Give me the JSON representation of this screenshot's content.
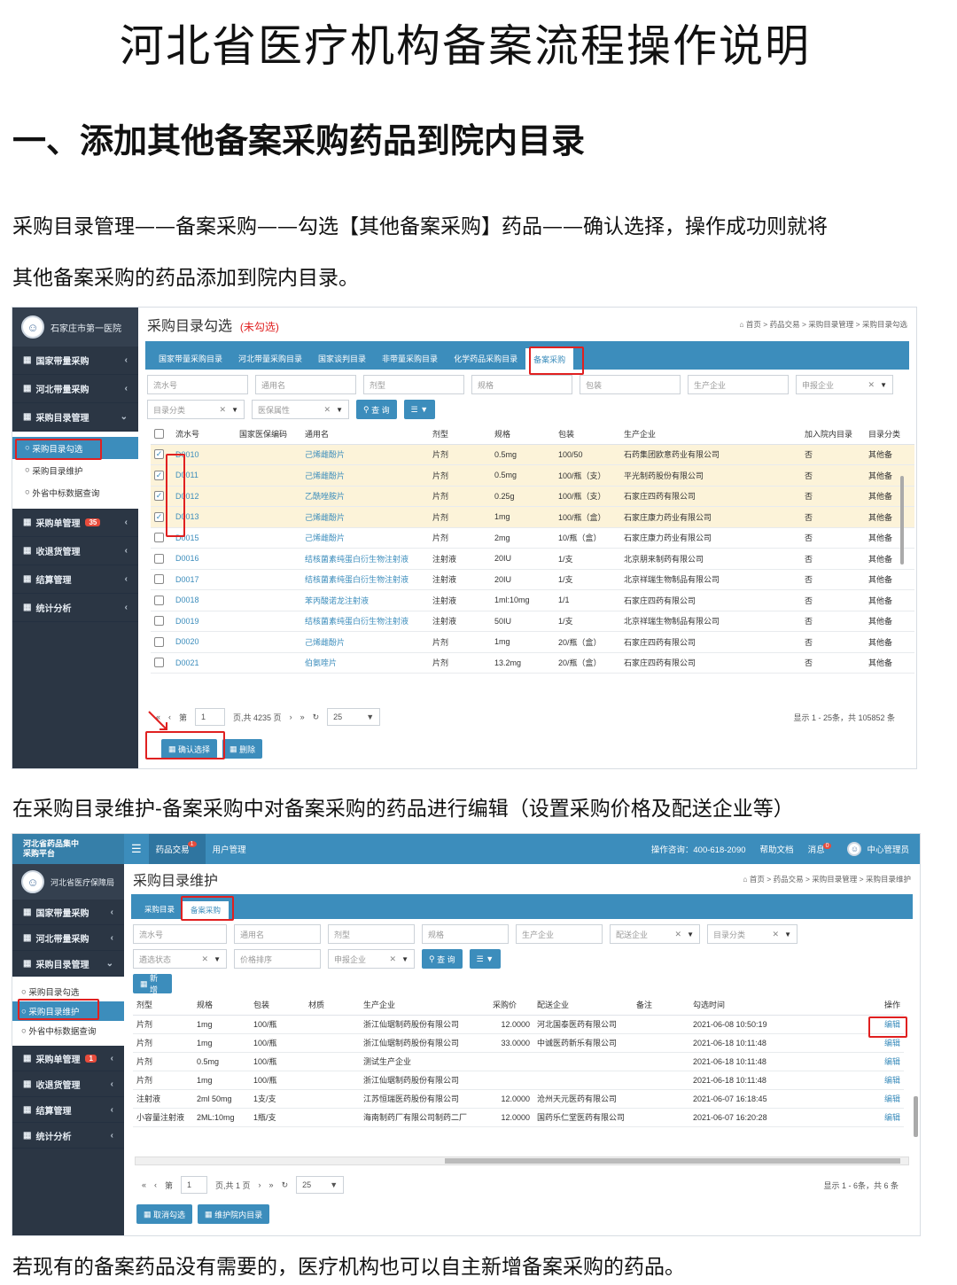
{
  "doc": {
    "title": "河北省医疗机构备案流程操作说明",
    "section1": "一、添加其他备案采购药品到院内目录",
    "para1": "采购目录管理——备案采购——勾选【其他备案采购】药品——确认选择，操作成功则就将",
    "para2": "其他备案采购的药品添加到院内目录。",
    "para3": "在采购目录维护-备案采购中对备案采购的药品进行编辑（设置采购价格及配送企业等）",
    "para4": "若现有的备案药品没有需要的，医疗机构也可以自主新增备案采购的药品。"
  },
  "shot1": {
    "user": "石家庄市第一医院",
    "menu": [
      {
        "label": "国家带量采购"
      },
      {
        "label": "河北带量采购"
      },
      {
        "label": "采购目录管理"
      }
    ],
    "submenu": [
      "采购目录勾选",
      "采购目录维护",
      "外省中标数据查询"
    ],
    "menu2": [
      {
        "label": "采购单管理",
        "badge": "35"
      },
      {
        "label": "收退货管理"
      },
      {
        "label": "结算管理"
      },
      {
        "label": "统计分析"
      }
    ],
    "page_title": "采购目录勾选",
    "page_note": "(未勾选)",
    "breadcrumb": [
      "首页",
      "药品交易",
      "采购目录管理",
      "采购目录勾选"
    ],
    "tabs": [
      "国家带量采购目录",
      "河北带量采购目录",
      "国家谈判目录",
      "非带量采购目录",
      "化学药品采购目录",
      "备案采购"
    ],
    "filters_row1": [
      "流水号",
      "通用名",
      "剂型",
      "规格",
      "包装",
      "生产企业",
      "申报企业"
    ],
    "filters_row2": [
      "目录分类",
      "医保属性"
    ],
    "search_label": "查 询",
    "headers": [
      "流水号",
      "国家医保编码",
      "通用名",
      "剂型",
      "规格",
      "包装",
      "生产企业",
      "加入院内目录",
      "目录分类"
    ],
    "rows": [
      {
        "id": "D0010",
        "name": "己烯雌酚片",
        "form": "片剂",
        "spec": "0.5mg",
        "pack": "100/50",
        "maker": "石药集团欧意药业有限公司",
        "joined": "否",
        "cat": "其他备"
      },
      {
        "id": "D0011",
        "name": "己烯雌酚片",
        "form": "片剂",
        "spec": "0.5mg",
        "pack": "100/瓶（支）",
        "maker": "平光制药股份有限公司",
        "joined": "否",
        "cat": "其他备"
      },
      {
        "id": "D0012",
        "name": "乙酰唑胺片",
        "form": "片剂",
        "spec": "0.25g",
        "pack": "100/瓶（支）",
        "maker": "石家庄四药有限公司",
        "joined": "否",
        "cat": "其他备"
      },
      {
        "id": "D0013",
        "name": "己烯雌酚片",
        "form": "片剂",
        "spec": "1mg",
        "pack": "100/瓶（盒）",
        "maker": "石家庄康力药业有限公司",
        "joined": "否",
        "cat": "其他备"
      },
      {
        "id": "D0015",
        "name": "己烯雌酚片",
        "form": "片剂",
        "spec": "2mg",
        "pack": "10/瓶（盒）",
        "maker": "石家庄康力药业有限公司",
        "joined": "否",
        "cat": "其他备"
      },
      {
        "id": "D0016",
        "name": "结核菌素纯蛋白衍生物注射液",
        "form": "注射液",
        "spec": "20IU",
        "pack": "1/支",
        "maker": "北京朋来制药有限公司",
        "joined": "否",
        "cat": "其他备"
      },
      {
        "id": "D0017",
        "name": "结核菌素纯蛋白衍生物注射液",
        "form": "注射液",
        "spec": "20IU",
        "pack": "1/支",
        "maker": "北京祥瑞生物制品有限公司",
        "joined": "否",
        "cat": "其他备"
      },
      {
        "id": "D0018",
        "name": "苯丙酸诺龙注射液",
        "form": "注射液",
        "spec": "1ml:10mg",
        "pack": "1/1",
        "maker": "石家庄四药有限公司",
        "joined": "否",
        "cat": "其他备"
      },
      {
        "id": "D0019",
        "name": "结核菌素纯蛋白衍生物注射液",
        "form": "注射液",
        "spec": "50IU",
        "pack": "1/支",
        "maker": "北京祥瑞生物制品有限公司",
        "joined": "否",
        "cat": "其他备"
      },
      {
        "id": "D0020",
        "name": "己烯雌酚片",
        "form": "片剂",
        "spec": "1mg",
        "pack": "20/瓶（盒）",
        "maker": "石家庄四药有限公司",
        "joined": "否",
        "cat": "其他备"
      },
      {
        "id": "D0021",
        "name": "伯氨喹片",
        "form": "片剂",
        "spec": "13.2mg",
        "pack": "20/瓶（盒）",
        "maker": "石家庄四药有限公司",
        "joined": "否",
        "cat": "其他备"
      }
    ],
    "pager": {
      "page_label": "第",
      "page": "1",
      "total": "页,共 4235 页",
      "size": "25",
      "summary": "显示 1 - 25条，共 105852 条"
    },
    "btn_confirm": "确认选择",
    "btn_delete": "删除"
  },
  "shot2": {
    "brand_line1": "河北省药品集中",
    "brand_line2": "采购平台",
    "top_menu": [
      "药品交易",
      "用户管理"
    ],
    "top_badge": "1",
    "hotline": "操作咨询：400-618-2090",
    "help": "帮助文档",
    "msg": "消息",
    "msg_badge": "0",
    "admin": "中心管理员",
    "user": "河北省医疗保障局",
    "menu": [
      "国家带量采购",
      "河北带量采购",
      "采购目录管理"
    ],
    "submenu": [
      "采购目录勾选",
      "采购目录维护",
      "外省中标数据查询"
    ],
    "menu2": [
      {
        "label": "采购单管理",
        "badge": "1"
      },
      {
        "label": "收退货管理"
      },
      {
        "label": "结算管理"
      },
      {
        "label": "统计分析"
      }
    ],
    "page_title": "采购目录维护",
    "breadcrumb": [
      "首页",
      "药品交易",
      "采购目录管理",
      "采购目录维护"
    ],
    "tabs": [
      "采购目录",
      "备案采购"
    ],
    "filters_row1": [
      "流水号",
      "通用名",
      "剂型",
      "规格",
      "生产企业",
      "配送企业",
      "目录分类"
    ],
    "filters_row2": [
      "遴选状态",
      "价格排序",
      "申报企业"
    ],
    "search_label": "查 询",
    "add_label": "新增",
    "headers": [
      "剂型",
      "规格",
      "包装",
      "材质",
      "生产企业",
      "采购价",
      "配送企业",
      "备注",
      "勾选时间",
      "操作"
    ],
    "rows": [
      {
        "form": "片剂",
        "spec": "1mg",
        "pack": "100/瓶",
        "maker": "浙江仙琚制药股份有限公司",
        "price": "12.0000",
        "dist": "河北国泰医药有限公司",
        "time": "2021-06-08 10:50:19",
        "op": "编辑"
      },
      {
        "form": "片剂",
        "spec": "1mg",
        "pack": "100/瓶",
        "maker": "浙江仙琚制药股份有限公司",
        "price": "33.0000",
        "dist": "中诚医药新乐有限公司",
        "time": "2021-06-18 10:11:48",
        "op": "编辑"
      },
      {
        "form": "片剂",
        "spec": "0.5mg",
        "pack": "100/瓶",
        "maker": "测试生产企业",
        "price": "",
        "dist": "",
        "time": "2021-06-18 10:11:48",
        "op": "编辑"
      },
      {
        "form": "片剂",
        "spec": "1mg",
        "pack": "100/瓶",
        "maker": "浙江仙琚制药股份有限公司",
        "price": "",
        "dist": "",
        "time": "2021-06-18 10:11:48",
        "op": "编辑"
      },
      {
        "form": "注射液",
        "spec": "2ml 50mg",
        "pack": "1支/支",
        "maker": "江苏恒瑞医药股份有限公司",
        "price": "12.0000",
        "dist": "沧州天元医药有限公司",
        "time": "2021-06-07 16:18:45",
        "op": "编辑"
      },
      {
        "form": "小容量注射液",
        "spec": "2ML:10mg",
        "pack": "1瓶/支",
        "maker": "海南制药厂有限公司制药二厂",
        "price": "12.0000",
        "dist": "国药乐仁堂医药有限公司",
        "time": "2021-06-07 16:20:28",
        "op": "编辑"
      }
    ],
    "pager": {
      "page_label": "第",
      "page": "1",
      "total": "页,共 1 页",
      "size": "25",
      "summary": "显示 1 - 6条，共 6 条"
    },
    "btn_cancel": "取消勾选",
    "btn_maintain": "维护院内目录"
  }
}
